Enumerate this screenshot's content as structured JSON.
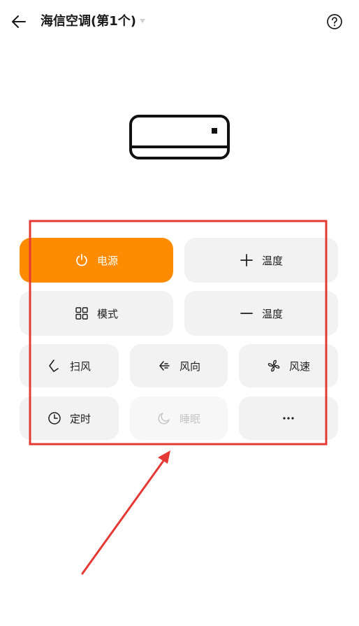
{
  "header": {
    "title": "海信空调(第1个)",
    "back_icon": "arrow-left-icon",
    "help_icon": "question-circle-icon"
  },
  "device": {
    "icon": "air-conditioner-icon"
  },
  "controls": {
    "power": {
      "label": "电源",
      "icon": "power-icon"
    },
    "temp_up": {
      "label": "温度",
      "icon": "plus-icon"
    },
    "mode": {
      "label": "模式",
      "icon": "grid-icon"
    },
    "temp_down": {
      "label": "温度",
      "icon": "minus-icon"
    },
    "swing": {
      "label": "扫风",
      "icon": "swing-icon"
    },
    "direction": {
      "label": "风向",
      "icon": "wind-direction-icon"
    },
    "fan_speed": {
      "label": "风速",
      "icon": "fan-icon"
    },
    "timer": {
      "label": "定时",
      "icon": "clock-icon"
    },
    "sleep": {
      "label": "睡眠",
      "icon": "moon-icon",
      "disabled": true
    },
    "more": {
      "icon": "more-horizontal-icon"
    }
  },
  "colors": {
    "accent": "#ff8c00",
    "button_bg": "#f2f2f3",
    "annotation": "#e53935"
  }
}
